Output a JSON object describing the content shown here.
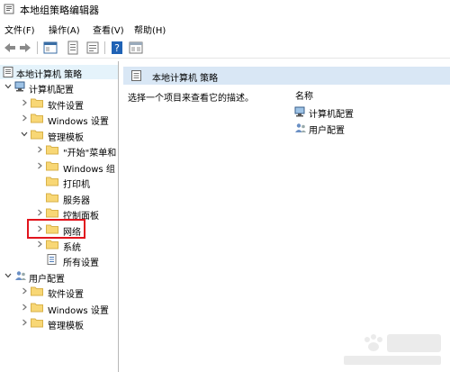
{
  "window": {
    "title": "本地组策略编辑器"
  },
  "menu": {
    "file": "文件(F)",
    "action": "操作(A)",
    "view": "查看(V)",
    "help": "帮助(H)"
  },
  "toolbar": {
    "buttons": [
      "back-arrow-icon",
      "forward-arrow-icon",
      "show-hide-tree-icon",
      "properties-icon",
      "export-list-icon",
      "help-icon",
      "extended-view-icon"
    ]
  },
  "tree": {
    "root": "本地计算机 策略",
    "computer_config": "计算机配置",
    "software_settings": "软件设置",
    "windows_settings": "Windows 设置",
    "admin_templates": "管理模板",
    "start_menu": "\"开始\"菜单和",
    "windows_components": "Windows 组",
    "printers": "打印机",
    "server": "服务器",
    "control_panel": "控制面板",
    "network": "网络",
    "system": "系统",
    "all_settings": "所有设置",
    "user_config": "用户配置",
    "user_software_settings": "软件设置",
    "user_windows_settings": "Windows 设置",
    "user_admin_templates": "管理模板"
  },
  "details": {
    "header": "本地计算机 策略",
    "description": "选择一个项目来查看它的描述。",
    "column_name": "名称",
    "items": [
      "计算机配置",
      "用户配置"
    ]
  },
  "colors": {
    "highlight_border": "#e1141d",
    "header_bg": "#d9e7f5",
    "selected_row_bg": "#e5f3fb"
  }
}
